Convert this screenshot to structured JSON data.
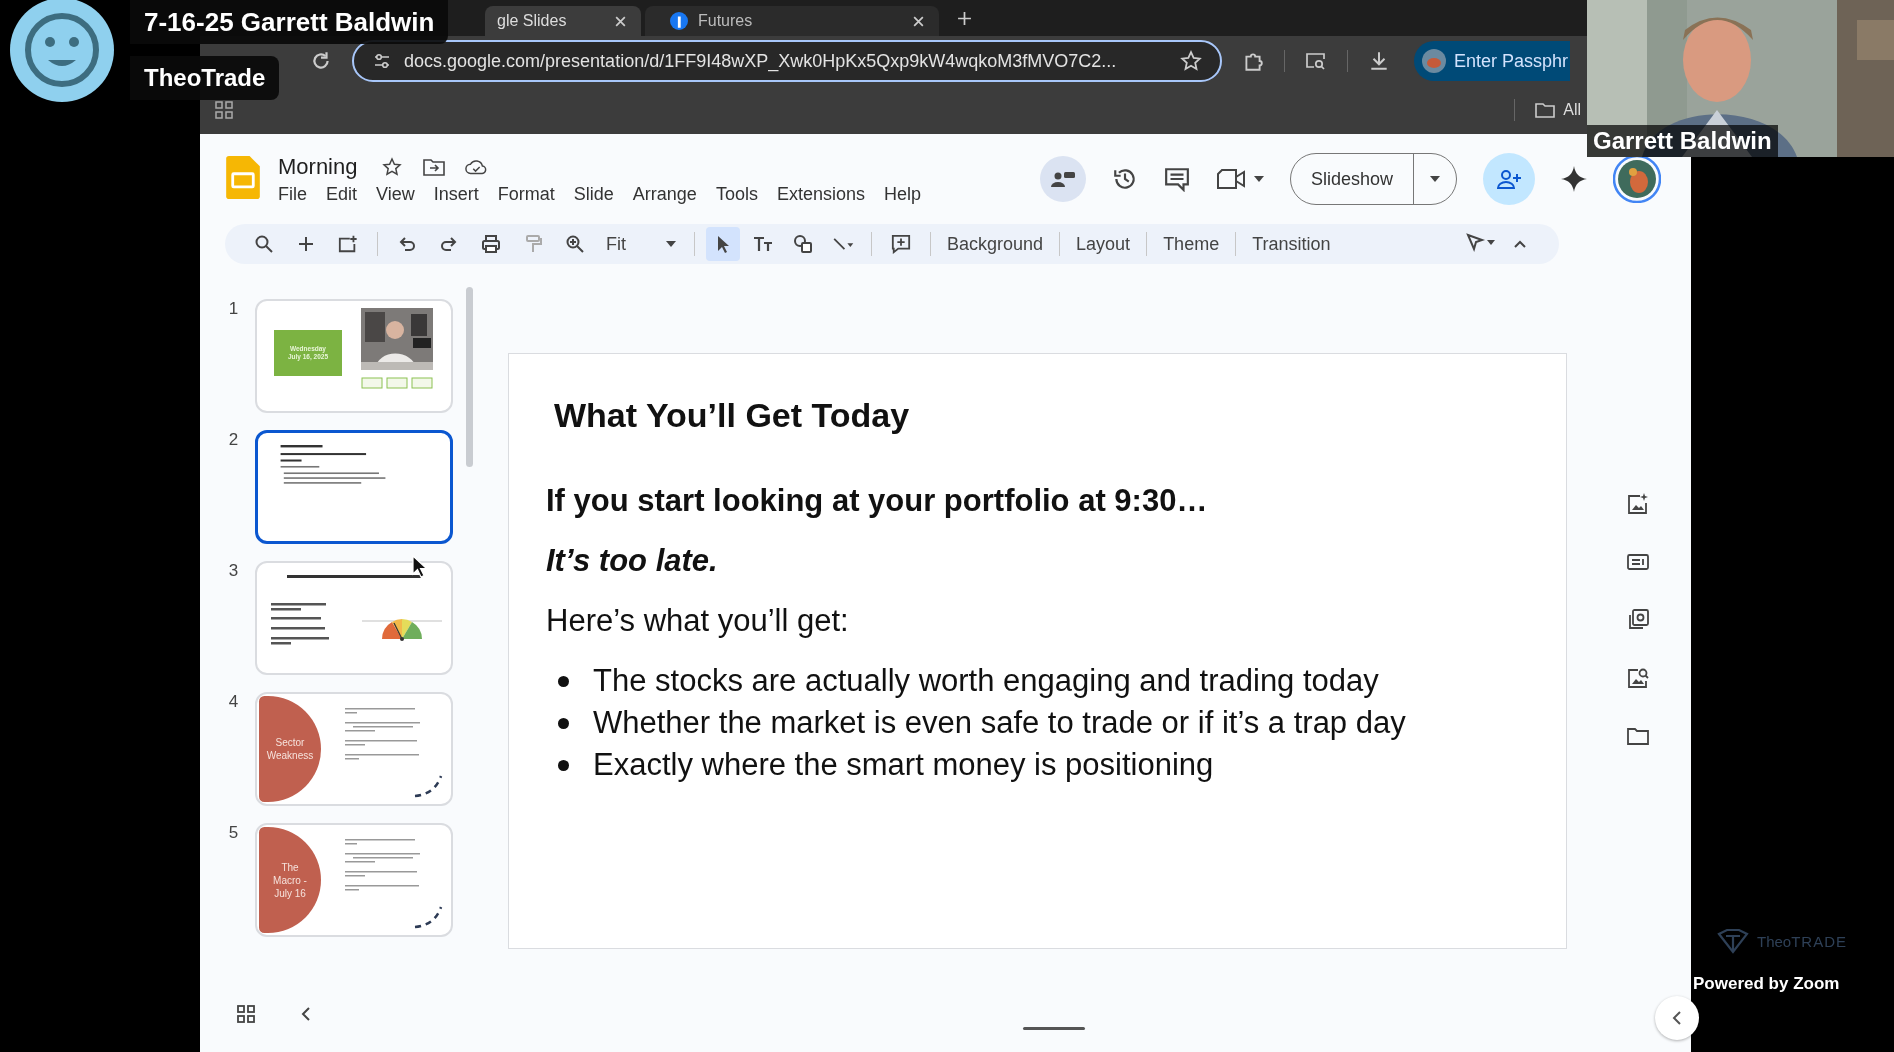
{
  "meeting": {
    "title": "7-16-25 Garrett Baldwin",
    "host": "TheoTrade"
  },
  "browser": {
    "tabs": [
      {
        "label": "gle Slides",
        "selected": true
      },
      {
        "label": "Futures",
        "selected": false
      }
    ],
    "url": "docs.google.com/presentation/d/1FF9I48wXP_Xwk0HpKx5Qxp9kW4wqkoM3fMVO7C2...",
    "profile_button": "Enter Passphr",
    "bookmark_folder": "All"
  },
  "app": {
    "doc_title": "Morning",
    "menu": [
      "File",
      "Edit",
      "View",
      "Insert",
      "Format",
      "Slide",
      "Arrange",
      "Tools",
      "Extensions",
      "Help"
    ],
    "slideshow": "Slideshow",
    "zoom": "Fit",
    "tools": [
      {
        "kind": "select",
        "selected": true
      },
      {
        "kind": "text",
        "selected": false
      },
      {
        "kind": "shape",
        "selected": false
      },
      {
        "kind": "line",
        "selected": false
      }
    ],
    "toolbar_buttons": [
      "Background",
      "Layout",
      "Theme",
      "Transition"
    ]
  },
  "filmstrip": [
    {
      "number": "1",
      "selected": false,
      "kind": "cover",
      "lines": [
        "Wednesday",
        "July 16, 2025"
      ]
    },
    {
      "number": "2",
      "selected": true,
      "kind": "text"
    },
    {
      "number": "3",
      "selected": false,
      "kind": "market"
    },
    {
      "number": "4",
      "selected": false,
      "kind": "section",
      "lines": [
        "Sector",
        "Weakness"
      ]
    },
    {
      "number": "5",
      "selected": false,
      "kind": "section",
      "lines": [
        "The",
        "Macro -",
        "July 16"
      ]
    }
  ],
  "slide": {
    "title": "What You’ll Get Today",
    "lead": "If you start looking at your portfolio at 9:30…",
    "emphasis": "It’s too late.",
    "intro": "Here’s what you’ll get:",
    "bullets": [
      "The stocks are actually worth engaging and trading today",
      "Whether the market is even safe to trade or if it’s a trap day",
      "Exactly where the smart money is positioning"
    ]
  },
  "camera": {
    "name": "Garrett Baldwin"
  },
  "branding": {
    "logo_light": "Theo",
    "logo_bold": "TRADE",
    "footer": "Powered by Zoom"
  }
}
